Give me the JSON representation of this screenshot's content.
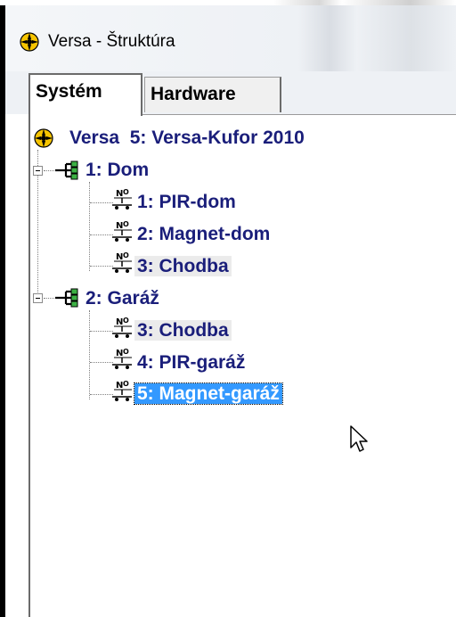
{
  "window": {
    "title": "Versa - Štruktúra"
  },
  "tabs": [
    {
      "label": "Systém",
      "active": true
    },
    {
      "label": "Hardware",
      "active": false
    }
  ],
  "tree": {
    "root": {
      "name": "Versa",
      "detail": "5: Versa-Kufor 2010"
    },
    "groups": [
      {
        "label": "1: Dom",
        "expanded": true,
        "zones": [
          {
            "label": "1: PIR-dom",
            "icon_text": "NO",
            "state": "normal"
          },
          {
            "label": "2: Magnet-dom",
            "icon_text": "NO",
            "state": "normal"
          },
          {
            "label": "3: Chodba",
            "icon_text": "NO",
            "state": "highlighted"
          }
        ]
      },
      {
        "label": "2: Garáž",
        "expanded": true,
        "zones": [
          {
            "label": "3: Chodba",
            "icon_text": "NO",
            "state": "highlighted"
          },
          {
            "label": "4: PIR-garáž",
            "icon_text": "NO",
            "state": "normal"
          },
          {
            "label": "5: Magnet-garáž",
            "icon_text": "NO",
            "state": "selected"
          }
        ]
      }
    ]
  },
  "colors": {
    "tree_text": "#1a1e7a",
    "selection_bg": "#3399ff",
    "highlight_bg": "#ebebeb",
    "frame": "#000000"
  },
  "icons": {
    "app": "versa-gear-icon",
    "partition": "partition-network-icon",
    "zone": "normally-open-contact-icon",
    "cursor": "mouse-pointer-icon"
  }
}
